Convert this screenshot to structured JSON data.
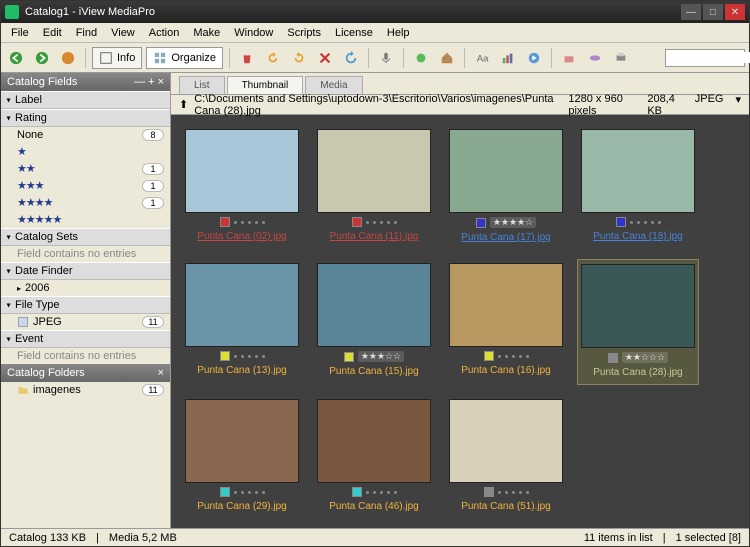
{
  "window": {
    "title": "Catalog1 - iView MediaPro"
  },
  "menu": [
    "File",
    "Edit",
    "Find",
    "View",
    "Action",
    "Make",
    "Window",
    "Scripts",
    "License",
    "Help"
  ],
  "toolbar": {
    "info": "Info",
    "organize": "Organize",
    "search_placeholder": ""
  },
  "sidebar": {
    "catalog_fields": {
      "title": "Catalog Fields",
      "sections": [
        "Label",
        "Rating",
        "Catalog Sets",
        "Date Finder",
        "File Type",
        "Event"
      ]
    },
    "rating": [
      {
        "label": "None",
        "count": 8
      },
      {
        "label": "1",
        "count": ""
      },
      {
        "label": "2",
        "count": 1
      },
      {
        "label": "3",
        "count": 1
      },
      {
        "label": "4",
        "count": 1
      },
      {
        "label": "5",
        "count": ""
      }
    ],
    "empty_text": "Field contains no entries",
    "date_finder": [
      "2006"
    ],
    "file_type": [
      {
        "label": "JPEG",
        "count": 11
      }
    ],
    "catalog_folders": {
      "title": "Catalog Folders",
      "items": [
        {
          "label": "imagenes",
          "count": 11
        }
      ]
    }
  },
  "main": {
    "tabs": [
      "List",
      "Thumbnail",
      "Media"
    ],
    "path": "C:\\Documents and Settings\\uptodown-3\\Escritorio\\Varios\\imagenes\\Punta Cana (28).jpg",
    "meta": {
      "dimensions": "1280 x 960 pixels",
      "size": "208,4 KB",
      "format": "JPEG"
    },
    "thumbs": [
      {
        "name": "Punta Cana (02).jpg",
        "color": "#c33",
        "capclass": "red",
        "bg": "#a7c7d8",
        "rating": 0
      },
      {
        "name": "Punta Cana (11).jpg",
        "color": "#c33",
        "capclass": "red",
        "bg": "#c8c8b0",
        "rating": 0
      },
      {
        "name": "Punta Cana (17).jpg",
        "color": "#33c",
        "capclass": "blue",
        "bg": "#88a890",
        "rating": 4
      },
      {
        "name": "Punta Cana (18).jpg",
        "color": "#33c",
        "capclass": "blue",
        "bg": "#9ab8a8",
        "rating": 0
      },
      {
        "name": "Punta Cana (13).jpg",
        "color": "#dd3",
        "capclass": "",
        "bg": "#6a95a8",
        "rating": 0
      },
      {
        "name": "Punta Cana (15).jpg",
        "color": "#dd3",
        "capclass": "",
        "bg": "#5a8598",
        "rating": 3
      },
      {
        "name": "Punta Cana (16).jpg",
        "color": "#dd3",
        "capclass": "",
        "bg": "#b89860",
        "rating": 0
      },
      {
        "name": "Punta Cana (28).jpg",
        "color": "#888",
        "capclass": "cy",
        "bg": "#3a5858",
        "rating": 2,
        "selected": true
      },
      {
        "name": "Punta Cana (29).jpg",
        "color": "#3cc",
        "capclass": "",
        "bg": "#8a6850",
        "rating": 0
      },
      {
        "name": "Punta Cana (46).jpg",
        "color": "#3cc",
        "capclass": "",
        "bg": "#7a5840",
        "rating": 0
      },
      {
        "name": "Punta Cana (51).jpg",
        "color": "#888",
        "capclass": "",
        "bg": "#d8d0b8",
        "rating": 0
      }
    ]
  },
  "status": {
    "catalog": "Catalog  133 KB",
    "media": "Media 5,2 MB",
    "items": "11 items in list",
    "selected": "1 selected [8]"
  }
}
